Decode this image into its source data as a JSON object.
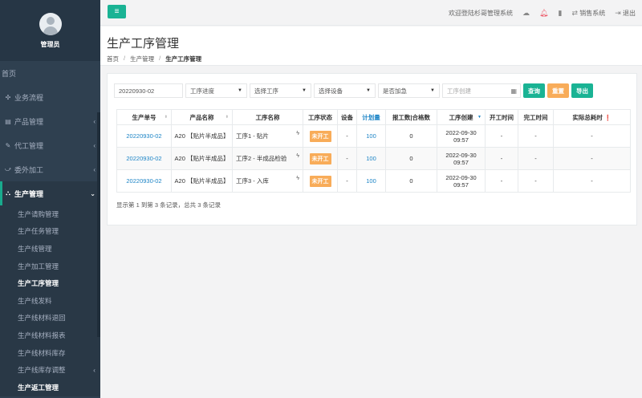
{
  "profile": {
    "name": "管理员"
  },
  "sidebar": {
    "items": [
      {
        "label": "首页",
        "icon": ""
      },
      {
        "label": "业务流程",
        "icon": "✣"
      },
      {
        "label": "产品管理",
        "icon": "▤"
      },
      {
        "label": "代工管理",
        "icon": "✎"
      },
      {
        "label": "委外加工",
        "icon": "⤻"
      },
      {
        "label": "生产管理",
        "icon": "⛬"
      }
    ],
    "sub_items": [
      "生产请购管理",
      "生产任务管理",
      "生产线管理",
      "生产加工管理",
      "生产工序管理",
      "生产线发料",
      "生产线材料退回",
      "生产线材料报表",
      "生产线材料库存",
      "生产线库存调整",
      "生产返工管理"
    ]
  },
  "topbar": {
    "menu_icon": "≡",
    "welcome": "欢迎登陆杉哥管理系统",
    "sales": "销售系统",
    "logout": "退出"
  },
  "header": {
    "title": "生产工序管理",
    "breadcrumb": [
      "首页",
      "生产管理",
      "生产工序管理"
    ]
  },
  "filters": {
    "order_no": "20220930-02",
    "progress": "工序进度",
    "process": "选择工序",
    "device": "选择设备",
    "urgent": "是否加急",
    "created_placeholder": "工序创建",
    "query": "查询",
    "reset": "重置",
    "export": "导出"
  },
  "table": {
    "headers": [
      "生产单号",
      "产品名称",
      "工序名称",
      "工序状态",
      "设备",
      "计划量",
      "报工数|合格数",
      "工序创建",
      "开工时间",
      "完工时间",
      "实际总耗时"
    ],
    "rows": [
      {
        "order": "20220930-02",
        "product": "A20 【贴片半成品】",
        "process": "工序1 - 贴片",
        "status": "未开工",
        "device": "-",
        "plan": "100",
        "report": "0",
        "created_date": "2022-09-30",
        "created_time": "09:57",
        "start": "-",
        "finish": "-",
        "total": "-"
      },
      {
        "order": "20220930-02",
        "product": "A20 【贴片半成品】",
        "process": "工序2 - 半成品检验",
        "status": "未开工",
        "device": "-",
        "plan": "100",
        "report": "0",
        "created_date": "2022-09-30",
        "created_time": "09:57",
        "start": "-",
        "finish": "-",
        "total": "-"
      },
      {
        "order": "20220930-02",
        "product": "A20 【贴片半成品】",
        "process": "工序3 - 入库",
        "status": "未开工",
        "device": "-",
        "plan": "100",
        "report": "0",
        "created_date": "2022-09-30",
        "created_time": "09:57",
        "start": "-",
        "finish": "-",
        "total": "-"
      }
    ],
    "pager_info": "显示第 1 到第 3 条记录，总共 3 条记录"
  }
}
